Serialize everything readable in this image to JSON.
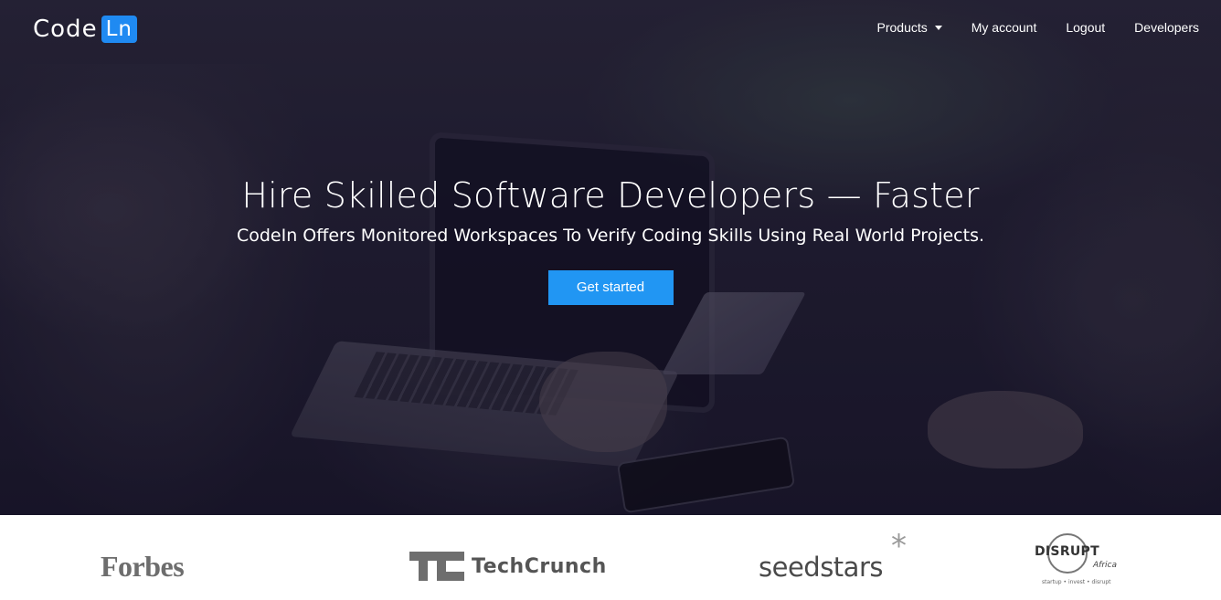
{
  "brand": {
    "word": "Code",
    "box": "Ln"
  },
  "nav": {
    "items": [
      {
        "label": "Products",
        "has_dropdown": true
      },
      {
        "label": "My account"
      },
      {
        "label": "Logout"
      },
      {
        "label": "Developers"
      }
    ]
  },
  "hero": {
    "title": "Hire Skilled Software Developers — Faster",
    "subtitle": "CodeIn Offers Monitored Workspaces To Verify Coding Skills Using Real World Projects.",
    "cta_label": "Get started"
  },
  "press": {
    "logos": [
      {
        "name": "Forbes",
        "text": "Forbes"
      },
      {
        "name": "TechCrunch",
        "text": "TechCrunch"
      },
      {
        "name": "Seedstars",
        "text": "seedstars",
        "mark": "*"
      },
      {
        "name": "Disrupt Africa",
        "text": "DISRUPT",
        "sub": "Africa",
        "tagline": "startup • invest • disrupt"
      }
    ]
  },
  "colors": {
    "accent": "#2196f3",
    "brand_box": "#1f8af2",
    "hero_overlay": "#1d1a2c"
  }
}
